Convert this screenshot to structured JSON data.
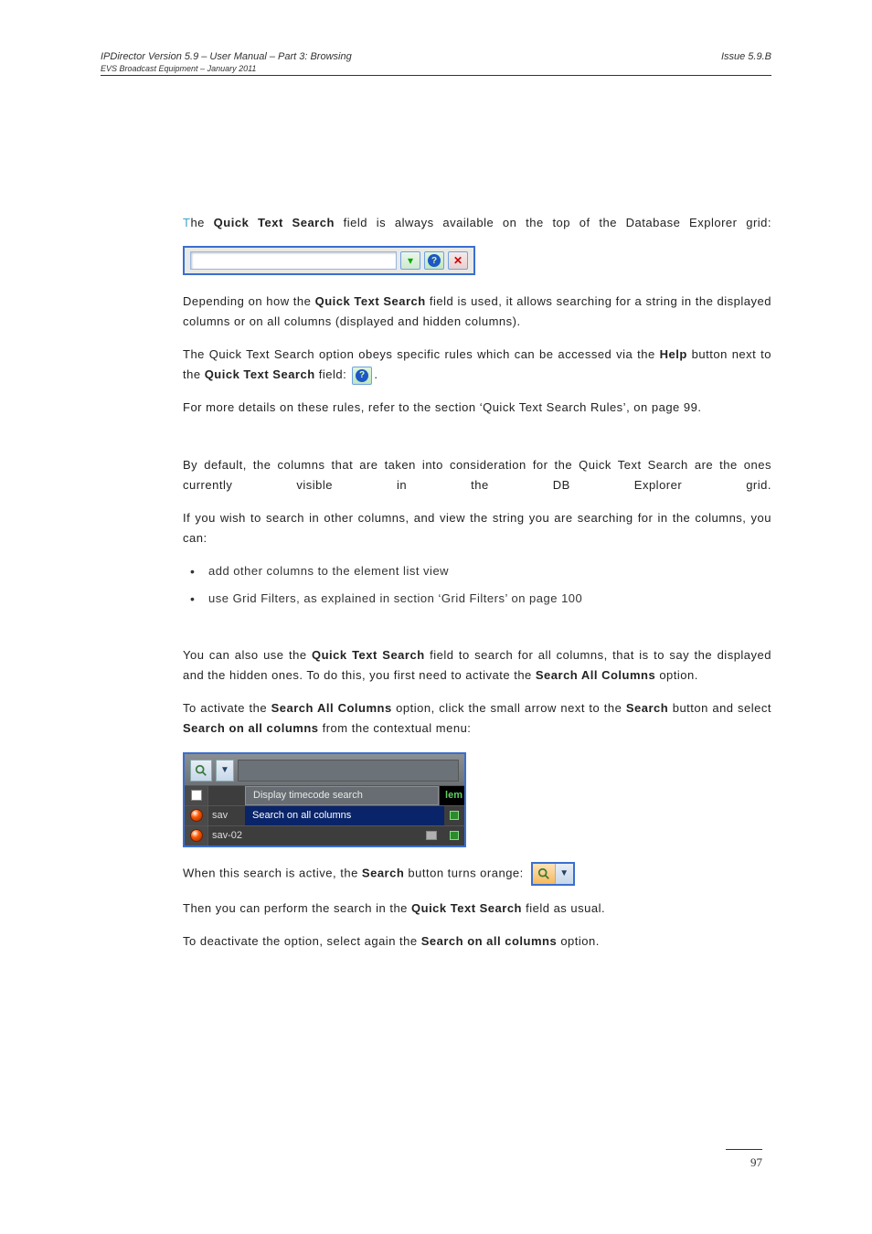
{
  "header": {
    "left": "IPDirector Version 5.9 – User Manual – Part 3: Browsing",
    "right": "Issue 5.9.B",
    "sub": "EVS Broadcast Equipment – January 2011"
  },
  "snippets": {
    "t1": "T",
    "p1a": "he ",
    "p1b": "Quick Text Search",
    "p1c": " field is always available on the top of the Database Explorer grid:",
    "p2a": "Depending on how the ",
    "p2b": "Quick Text Search",
    "p2c": " field is used, it allows searching for a string in the displayed columns or on all columns (displayed and hidden columns).",
    "p3a": "The Quick Text Search option obeys specific rules which can be accessed via the ",
    "p3b": "Help",
    "p3c": " button next to the ",
    "p3d": "Quick Text Search",
    "p3e": " field: ",
    "p4": "For more details on these rules, refer to the section ‘Quick Text Search Rules’, on page 99.",
    "p5": "By default, the columns that are taken into consideration for the Quick Text Search are the ones currently visible in the DB Explorer grid.",
    "p6": "If you wish to search in other columns, and view the string you are searching for in the columns, you can:",
    "li1": "add other columns to the element list view",
    "li2": "use Grid Filters, as explained in section ‘Grid Filters’ on page 100",
    "p7a": "You can also use the ",
    "p7b": "Quick Text Search",
    "p7c": " field to search for all columns, that is to say the displayed and the hidden ones. To do this, you first need to activate the ",
    "p7d": "Search All Columns",
    "p7e": " option.",
    "p8a": "To activate the ",
    "p8b": "Search All Columns",
    "p8c": " option, click the small arrow next to the ",
    "p8d": "Search",
    "p8e": " button and select ",
    "p8f": "Search on all columns",
    "p8g": " from the contextual menu:",
    "p9a": "When this search is active, the ",
    "p9b": "Search",
    "p9c": " button turns orange: ",
    "p10a": "Then you can perform the search in the ",
    "p10b": "Quick Text Search",
    "p10c": " field as usual.",
    "p11a": "To deactivate the option, select again the ",
    "p11b": "Search on all columns",
    "p11c": " option."
  },
  "menu": {
    "opt1": "Display timecode search",
    "opt2": "Search on all columns",
    "row1": "sav",
    "row2": "sav-02",
    "tag": "lem"
  },
  "pageNum": "97"
}
